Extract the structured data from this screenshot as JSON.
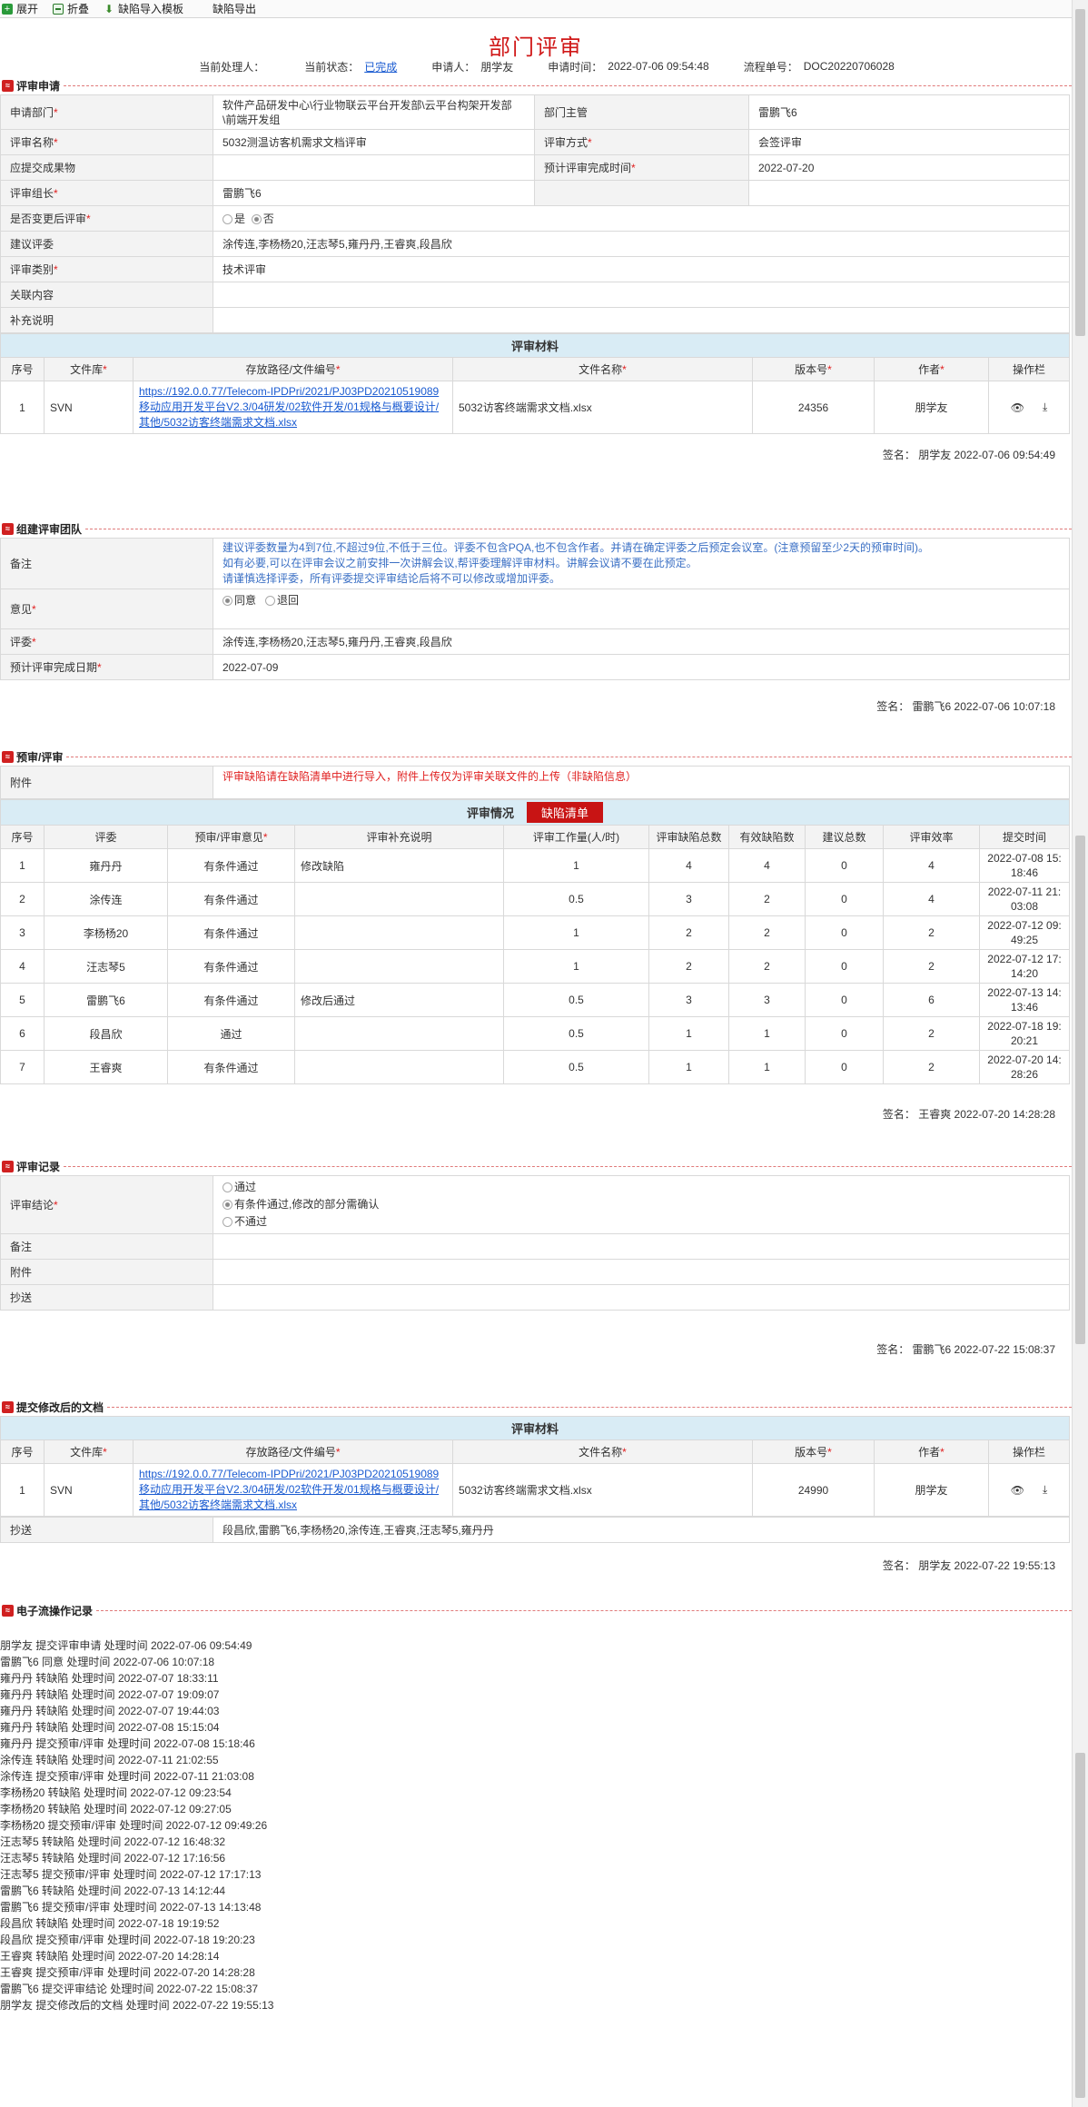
{
  "toolbar": {
    "expand": "展开",
    "fold": "折叠",
    "import_tpl": "缺陷导入模板",
    "export": "缺陷导出"
  },
  "title": "部门评审",
  "meta": {
    "handler_label": "当前处理人：",
    "status_label": "当前状态：",
    "status_value": "已完成",
    "applicant_label": "申请人：",
    "applicant_value": "朋学友",
    "time_label": "申请时间：",
    "time_value": "2022-07-06 09:54:48",
    "flow_label": "流程单号：",
    "flow_value": "DOC20220706028"
  },
  "apply": {
    "section": "评审申请",
    "dept_label": "申请部门",
    "dept_value": "软件产品研发中心\\行业物联云平台开发部\\云平台构架开发部\\前端开发组",
    "manager_label": "部门主管",
    "manager_value": "雷鹏飞6",
    "name_label": "评审名称",
    "name_value": "5032测温访客机需求文档评审",
    "method_label": "评审方式",
    "method_value": "会签评审",
    "deliverable_label": "应提交成果物",
    "deliverable_value": "",
    "planned_label": "预计评审完成时间",
    "planned_value": "2022-07-20",
    "leader_label": "评审组长",
    "leader_value": "雷鹏飞6",
    "change_label": "是否变更后评审",
    "change_yes": "是",
    "change_no": "否",
    "suggest_label": "建议评委",
    "suggest_value": "涂传连,李杨杨20,汪志琴5,雍丹丹,王睿爽,段昌欣",
    "category_label": "评审类别",
    "category_value": "技术评审",
    "related_label": "关联内容",
    "related_value": "",
    "extra_label": "补充说明",
    "extra_value": "",
    "materials_title": "评审材料",
    "mat_headers": [
      "序号",
      "文件库",
      "存放路径/文件编号",
      "文件名称",
      "版本号",
      "作者",
      "操作栏"
    ],
    "materials": [
      {
        "no": "1",
        "repo": "SVN",
        "path": "https://192.0.0.77/Telecom-IPDPri/2021/PJ03PD20210519089移动应用开发平台V2.3/04研发/02软件开发/01规格与概要设计/其他/5032访客终端需求文档.xlsx",
        "file": "5032访客终端需求文档.xlsx",
        "version": "24356",
        "author": "朋学友"
      }
    ],
    "sign": "签名：  朋学友 2022-07-06 09:54:49"
  },
  "team": {
    "section": "组建评审团队",
    "remark_label": "备注",
    "remark_lines": [
      "建议评委数量为4到7位,不超过9位,不低于三位。评委不包含PQA,也不包含作者。并请在确定评委之后预定会议室。(注意预留至少2天的预审时间)。",
      "如有必要,可以在评审会议之前安排一次讲解会议,帮评委理解评审材料。讲解会议请不要在此预定。",
      "请谨慎选择评委，所有评委提交评审结论后将不可以修改或增加评委。"
    ],
    "opinion_label": "意见",
    "agree": "同意",
    "reject": "退回",
    "judges_label": "评委",
    "judges_value": "涂传连,李杨杨20,汪志琴5,雍丹丹,王睿爽,段昌欣",
    "date_label": "预计评审完成日期",
    "date_value": "2022-07-09",
    "sign": "签名：  雷鹏飞6 2022-07-06 10:07:18"
  },
  "pre": {
    "section": "预审/评审",
    "attach_label": "附件",
    "attach_note": "评审缺陷请在缺陷清单中进行导入，附件上传仅为评审关联文件的上传（非缺陷信息）",
    "situation": "评审情况",
    "defect_btn": "缺陷清单",
    "headers": [
      "序号",
      "评委",
      "预审/评审意见",
      "评审补充说明",
      "评审工作量(人/时)",
      "评审缺陷总数",
      "有效缺陷数",
      "建议总数",
      "评审效率",
      "提交时间"
    ],
    "rows": [
      {
        "no": "1",
        "judge": "雍丹丹",
        "opinion": "有条件通过",
        "note": "修改缺陷",
        "effort": "1",
        "total": "4",
        "valid": "4",
        "sugg": "0",
        "eff": "4",
        "time": "2022-07-08 15:18:46"
      },
      {
        "no": "2",
        "judge": "涂传连",
        "opinion": "有条件通过",
        "note": "",
        "effort": "0.5",
        "total": "3",
        "valid": "2",
        "sugg": "0",
        "eff": "4",
        "time": "2022-07-11 21:03:08"
      },
      {
        "no": "3",
        "judge": "李杨杨20",
        "opinion": "有条件通过",
        "note": "",
        "effort": "1",
        "total": "2",
        "valid": "2",
        "sugg": "0",
        "eff": "2",
        "time": "2022-07-12 09:49:25"
      },
      {
        "no": "4",
        "judge": "汪志琴5",
        "opinion": "有条件通过",
        "note": "",
        "effort": "1",
        "total": "2",
        "valid": "2",
        "sugg": "0",
        "eff": "2",
        "time": "2022-07-12 17:14:20"
      },
      {
        "no": "5",
        "judge": "雷鹏飞6",
        "opinion": "有条件通过",
        "note": "修改后通过",
        "effort": "0.5",
        "total": "3",
        "valid": "3",
        "sugg": "0",
        "eff": "6",
        "time": "2022-07-13 14:13:46"
      },
      {
        "no": "6",
        "judge": "段昌欣",
        "opinion": "通过",
        "note": "",
        "effort": "0.5",
        "total": "1",
        "valid": "1",
        "sugg": "0",
        "eff": "2",
        "time": "2022-07-18 19:20:21"
      },
      {
        "no": "7",
        "judge": "王睿爽",
        "opinion": "有条件通过",
        "note": "",
        "effort": "0.5",
        "total": "1",
        "valid": "1",
        "sugg": "0",
        "eff": "2",
        "time": "2022-07-20 14:28:26"
      }
    ],
    "sign": "签名：  王睿爽 2022-07-20 14:28:28"
  },
  "record": {
    "section": "评审记录",
    "conclusion_label": "评审结论",
    "opt1": "通过",
    "opt2": "有条件通过,修改的部分需确认",
    "opt3": "不通过",
    "remark_label": "备注",
    "attach_label": "附件",
    "cc_label": "抄送",
    "sign": "签名：  雷鹏飞6 2022-07-22 15:08:37"
  },
  "revised": {
    "section": "提交修改后的文档",
    "materials_title": "评审材料",
    "materials": [
      {
        "no": "1",
        "repo": "SVN",
        "path": "https://192.0.0.77/Telecom-IPDPri/2021/PJ03PD20210519089移动应用开发平台V2.3/04研发/02软件开发/01规格与概要设计/其他/5032访客终端需求文档.xlsx",
        "file": "5032访客终端需求文档.xlsx",
        "version": "24990",
        "author": "朋学友"
      }
    ],
    "cc_label": "抄送",
    "cc_value": "段昌欣,雷鹏飞6,李杨杨20,涂传连,王睿爽,汪志琴5,雍丹丹",
    "sign": "签名：  朋学友 2022-07-22 19:55:13"
  },
  "log": {
    "section": "电子流操作记录",
    "items": [
      "朋学友 提交评审申请 处理时间 2022-07-06 09:54:49",
      "雷鹏飞6 同意 处理时间 2022-07-06 10:07:18",
      "雍丹丹 转缺陷 处理时间 2022-07-07 18:33:11",
      "雍丹丹 转缺陷 处理时间 2022-07-07 19:09:07",
      "雍丹丹 转缺陷 处理时间 2022-07-07 19:44:03",
      "雍丹丹 转缺陷 处理时间 2022-07-08 15:15:04",
      "雍丹丹 提交预审/评审 处理时间 2022-07-08 15:18:46",
      "涂传连 转缺陷 处理时间 2022-07-11 21:02:55",
      "涂传连 提交预审/评审 处理时间 2022-07-11 21:03:08",
      "李杨杨20 转缺陷 处理时间 2022-07-12 09:23:54",
      "李杨杨20 转缺陷 处理时间 2022-07-12 09:27:05",
      "李杨杨20 提交预审/评审 处理时间 2022-07-12 09:49:26",
      "汪志琴5 转缺陷 处理时间 2022-07-12 16:48:32",
      "汪志琴5 转缺陷 处理时间 2022-07-12 17:16:56",
      "汪志琴5 提交预审/评审 处理时间 2022-07-12 17:17:13",
      "雷鹏飞6 转缺陷 处理时间 2022-07-13 14:12:44",
      "雷鹏飞6 提交预审/评审 处理时间 2022-07-13 14:13:48",
      "段昌欣 转缺陷 处理时间 2022-07-18 19:19:52",
      "段昌欣 提交预审/评审 处理时间 2022-07-18 19:20:23",
      "王睿爽 转缺陷 处理时间 2022-07-20 14:28:14",
      "王睿爽 提交预审/评审 处理时间 2022-07-20 14:28:28",
      "雷鹏飞6 提交评审结论 处理时间 2022-07-22 15:08:37",
      "朋学友 提交修改后的文档 处理时间 2022-07-22 19:55:13"
    ]
  }
}
